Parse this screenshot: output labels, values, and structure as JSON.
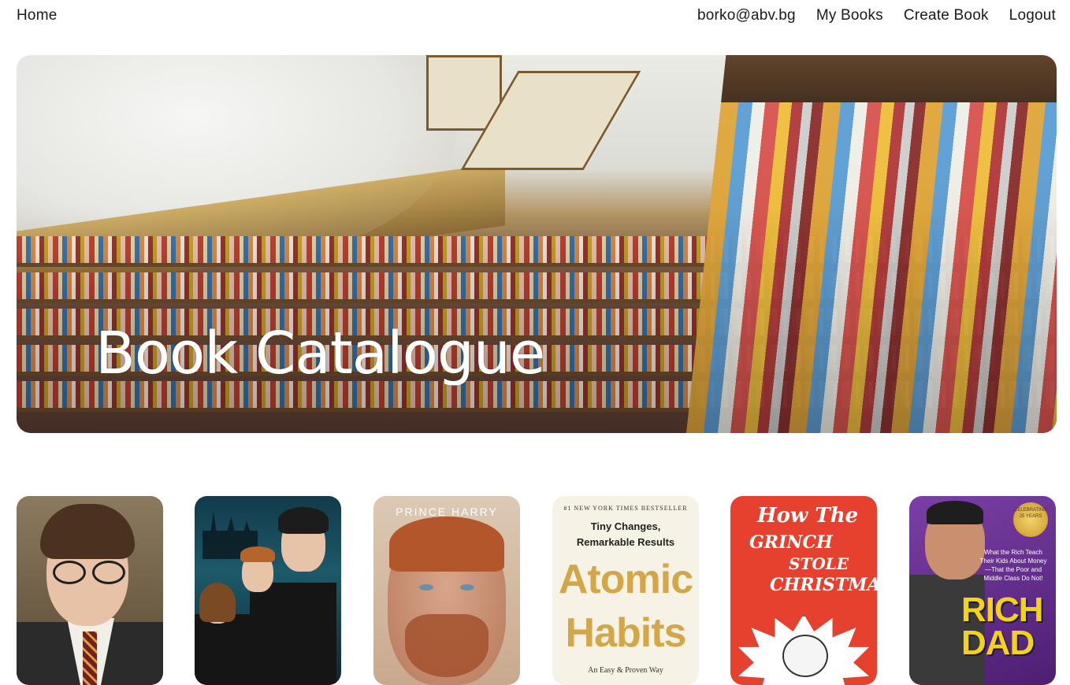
{
  "nav": {
    "home": "Home",
    "user_email": "borko@abv.bg",
    "my_books": "My Books",
    "create_book": "Create Book",
    "logout": "Logout"
  },
  "hero": {
    "title": "Book Catalogue"
  },
  "books": [
    {
      "cover": "harry-potter-portrait"
    },
    {
      "cover": "harry-potter-chamber-of-secrets"
    },
    {
      "cover": "spare",
      "cover_text": "PRINCE HARRY"
    },
    {
      "cover": "atomic-habits",
      "top_line": "#1 NEW YORK TIMES BESTSELLER",
      "subtitle_line1": "Tiny Changes,",
      "subtitle_line2": "Remarkable Results",
      "title_line1": "Atomic",
      "title_line2": "Habits",
      "tagline": "An Easy & Proven Way"
    },
    {
      "cover": "how-the-grinch-stole-christmas",
      "line1": "How The",
      "line2": "GRINCH",
      "line3": "STOLE",
      "line4": "CHRISTMAS!"
    },
    {
      "cover": "rich-dad-poor-dad",
      "seal": "CELEBRATING 25 YEARS",
      "blurb": "What the Rich Teach Their Kids About Money —That the Poor and Middle Class Do Not!",
      "title_line1": "RICH",
      "title_line2": "DAD"
    }
  ]
}
